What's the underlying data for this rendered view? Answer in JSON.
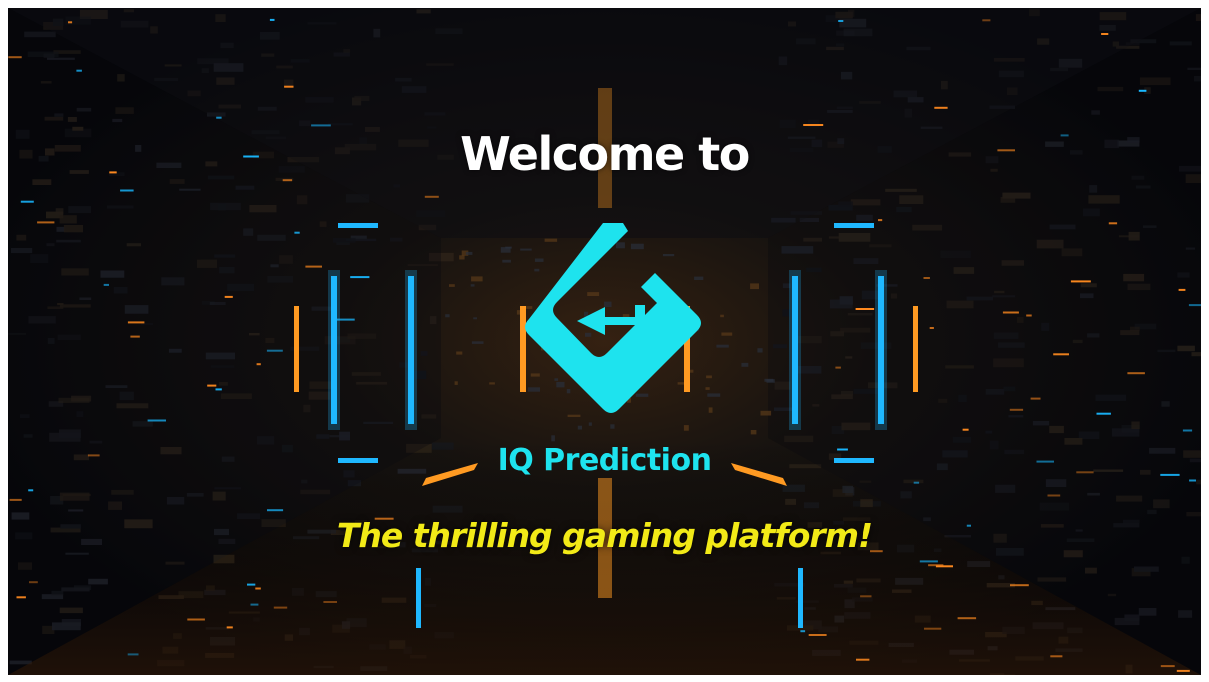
{
  "welcome": {
    "heading": "Welcome to"
  },
  "brand": {
    "name": "IQ Prediction",
    "logo_icon": "iq-prediction-logo-icon",
    "accent_color": "#1ee3ee"
  },
  "tagline": {
    "text": "The thrilling gaming platform!",
    "color": "#f2ea17"
  },
  "background": {
    "style": "neon sci-fi corridor",
    "colors": [
      "#07080d",
      "#ff8a1f",
      "#19b8ff"
    ]
  }
}
